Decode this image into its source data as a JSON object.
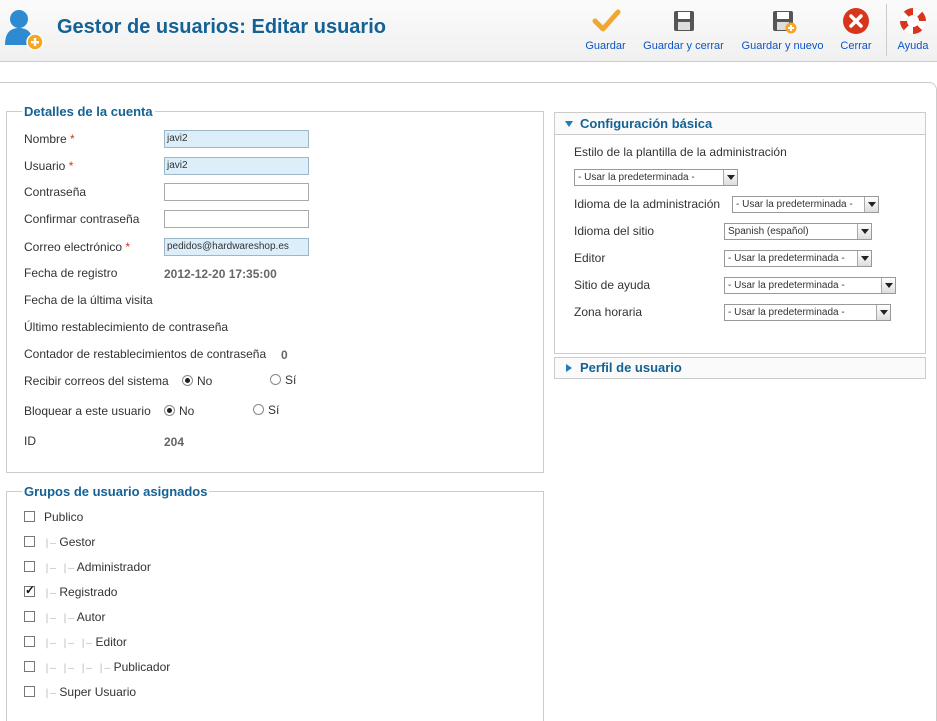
{
  "header": {
    "title": "Gestor de usuarios: Editar usuario",
    "icon": "user-add-icon",
    "toolbar": [
      {
        "label": "Guardar",
        "icon": "check-icon"
      },
      {
        "label": "Guardar y cerrar",
        "icon": "save-icon"
      },
      {
        "label": "Guardar y nuevo",
        "icon": "save-new-icon"
      },
      {
        "label": "Cerrar",
        "icon": "close-icon"
      },
      {
        "label": "Ayuda",
        "icon": "help-lifebuoy-icon"
      }
    ]
  },
  "account": {
    "legend": "Detalles de la cuenta",
    "required_mark": "*",
    "name_label": "Nombre",
    "name_value": "javi2",
    "username_label": "Usuario",
    "username_value": "javi2",
    "password_label": "Contraseña",
    "password_value": "",
    "password2_label": "Confirmar contraseña",
    "password2_value": "",
    "email_label": "Correo electrónico",
    "email_value": "pedidos@hardwareshop.es",
    "register_label": "Fecha de registro",
    "register_value": "2012-12-20 17:35:00",
    "lastvisit_label": "Fecha de la última visita",
    "lastreset_label": "Último restablecimiento de contraseña",
    "resetcount_label": "Contador de restablecimientos de contraseña",
    "resetcount_value": "0",
    "sendemail_label": "Recibir correos del sistema",
    "block_label": "Bloquear a este usuario",
    "opt_no": "No",
    "opt_yes": "Sí",
    "sendemail_selected": "No",
    "block_selected": "No",
    "id_label": "ID",
    "id_value": "204"
  },
  "groups": {
    "legend": "Grupos de usuario asignados",
    "items": [
      {
        "name": "Publico",
        "prefix": "",
        "checked": false
      },
      {
        "name": "Gestor",
        "prefix": "|—",
        "checked": false
      },
      {
        "name": "Administrador",
        "prefix": "|— |—",
        "checked": false
      },
      {
        "name": "Registrado",
        "prefix": "|—",
        "checked": true
      },
      {
        "name": "Autor",
        "prefix": "|— |—",
        "checked": false
      },
      {
        "name": "Editor",
        "prefix": "|— |— |—",
        "checked": false
      },
      {
        "name": "Publicador",
        "prefix": "|— |— |— |—",
        "checked": false
      },
      {
        "name": "Super Usuario",
        "prefix": "|—",
        "checked": false
      }
    ]
  },
  "config": {
    "title": "Configuración básica",
    "admin_style_label": "Estilo de la plantilla de la administración",
    "admin_style_value": "- Usar la predeterminada -",
    "admin_lang_label": "Idioma de la administración",
    "admin_lang_value": "- Usar la predeterminada -",
    "site_lang_label": "Idioma del sitio",
    "site_lang_value": "Spanish (español)",
    "editor_label": "Editor",
    "editor_value": "- Usar la predeterminada -",
    "help_label": "Sitio de ayuda",
    "help_value": "- Usar la predeterminada -",
    "tz_label": "Zona horaria",
    "tz_value": "- Usar la predeterminada -"
  },
  "profile": {
    "title": "Perfil de usuario"
  },
  "colors": {
    "title_blue": "#146295",
    "link_blue": "#0b55c4",
    "required_red": "#d9341c",
    "filled_input_bg": "#dbeef9"
  }
}
